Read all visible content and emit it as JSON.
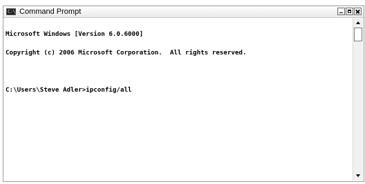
{
  "window": {
    "title": "Command Prompt",
    "icon_label": "C:\\"
  },
  "controls": {
    "minimize": "minimize-icon",
    "maximize": "maximize-icon",
    "close": "close-icon"
  },
  "console": {
    "lines": [
      "Microsoft Windows [Version 6.0.6000]",
      "Copyright (c) 2006 Microsoft Corporation.  All rights reserved.",
      "",
      "C:\\Users\\Steve Adler>ipconfig/all"
    ]
  },
  "colors": {
    "console_background": "#ffffff",
    "console_text": "#000000"
  }
}
